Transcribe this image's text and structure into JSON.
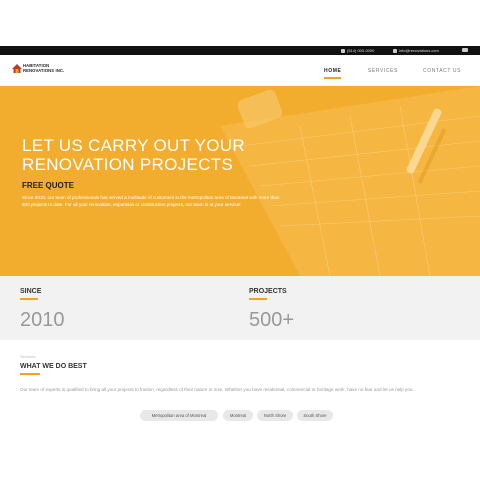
{
  "topbar": {
    "phone": "(514) 000-0000",
    "email": "info@renovations.com"
  },
  "header": {
    "logo_line1": "HABITATION",
    "logo_line2": "RENOVATIONS INC.",
    "nav": [
      {
        "label": "HOME",
        "active": true
      },
      {
        "label": "SERVICES",
        "active": false
      },
      {
        "label": "CONTACT US",
        "active": false
      }
    ]
  },
  "hero": {
    "title": "LET US CARRY OUT YOUR RENOVATION PROJECTS",
    "subtitle": "FREE QUOTE",
    "body": "Since 2010, our team of professionals has served a multitude of customers in the metropolitan area of Montreal with more than 500 projects to date. For all your renovation, expansion or construction projects, our team is at your service!",
    "accent": "#f3ad2e"
  },
  "stats": [
    {
      "label": "SINCE",
      "value": "2010"
    },
    {
      "label": "PROJECTS",
      "value": "500+"
    }
  ],
  "services": {
    "kicker": "Services",
    "title": "WHAT WE DO BEST",
    "description": "Our team of experts is qualified to bring all your projects to fruition, regardless of their nature or size. Whether you have residential, commercial or heritage work, have no fear and let us help you.",
    "tags": [
      "Metropolitan area of Montreal",
      "Montreal",
      "North Shore",
      "South Shore"
    ]
  }
}
